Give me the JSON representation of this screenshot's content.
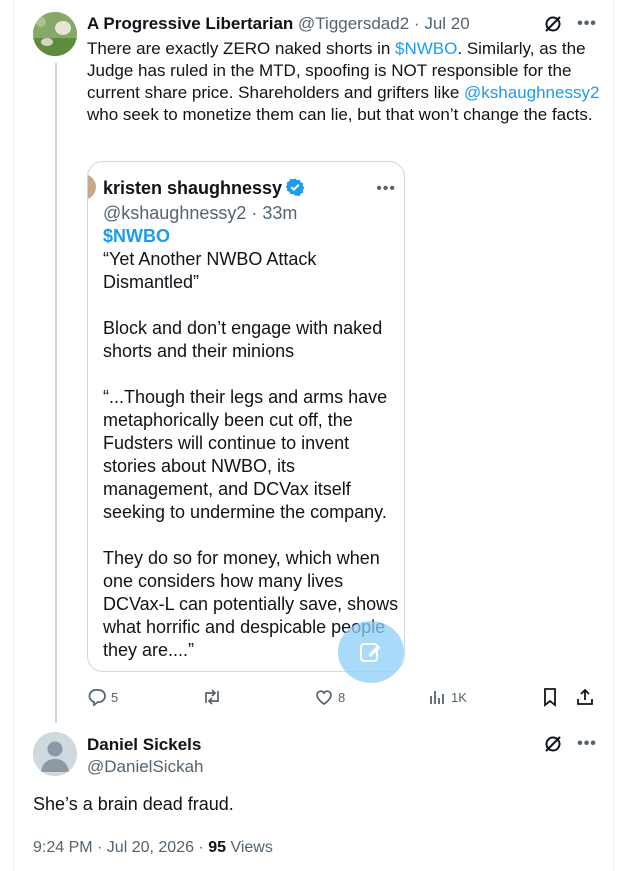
{
  "post": {
    "author_name": "A Progressive Libertarian",
    "handle": "@Tiggersdad2",
    "separator": "·",
    "date": "Jul 20",
    "text_part1": "There are exactly ZERO naked shorts in ",
    "cashtag": "$NWBO",
    "text_part2": ". Similarly, as the Judge has ruled in the MTD, spoofing is NOT responsible for the current share price. Shareholders and grifters like ",
    "mention": "@kshaughnessy2",
    "text_part3": " who seek to monetize them can lie, but that won’t change the facts."
  },
  "quote": {
    "author_name": "kristen shaughnessy",
    "handle_time": "@kshaughnessy2 · 33m",
    "cashtag": "$NWBO",
    "body": "“Yet Another NWBO Attack Dismantled”\n\nBlock and don’t engage with naked shorts and their minions\n\n“...Though their legs and arms have metaphorically been cut off, the Fudsters will continue to invent stories about NWBO, its management, and DCVax itself seeking to undermine the company.\n\nThey do so for money, which when one considers how many lives DCVax-L can potentially save, shows what horrific and despicable people they are....”"
  },
  "actions": {
    "replies": "5",
    "retweets": "",
    "likes": "8",
    "views": "1K"
  },
  "reply": {
    "author_name": "Daniel Sickels",
    "handle": "@DanielSickah",
    "text": "She’s a brain dead fraud.",
    "time": "9:24 PM · Jul 20, 2026 · ",
    "views_count": "95",
    "views_label": " Views"
  },
  "colors": {
    "accent": "#1d9bf0",
    "muted": "#536471",
    "text": "#0f1419",
    "border": "#cfd9de"
  },
  "icons": [
    "grok-slash-icon",
    "more-icon",
    "verified-icon",
    "reply-icon",
    "retweet-icon",
    "like-icon",
    "views-icon",
    "bookmark-icon",
    "share-icon",
    "compose-icon"
  ]
}
